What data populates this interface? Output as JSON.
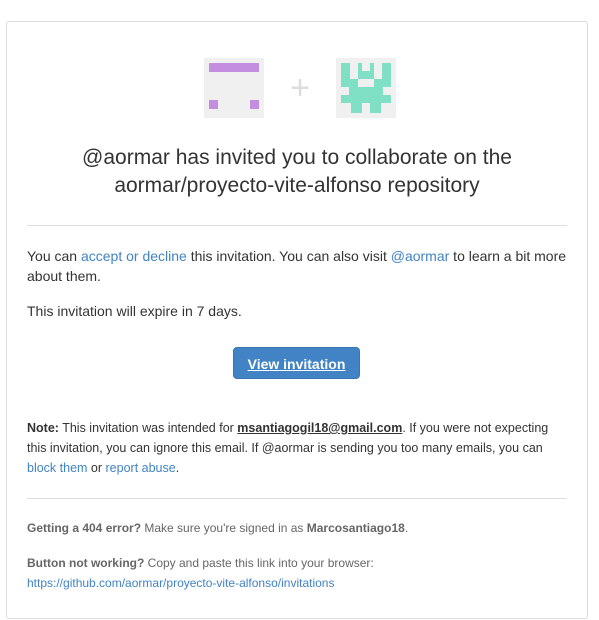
{
  "header": {
    "plus_sign": "+",
    "title_line1": "@aormar has invited you to collaborate on the",
    "title_line2": "aormar/proyecto-vite-alfonso repository"
  },
  "intro": {
    "text1": "You can ",
    "accept_link": "accept or decline",
    "text2": " this invitation. You can also visit ",
    "user_link": "@aormar",
    "text3": " to learn a bit more about them."
  },
  "expiry": "This invitation will expire in 7 days.",
  "button": {
    "label": "View invitation"
  },
  "note": {
    "label": "Note:",
    "text1": " This invitation was intended for ",
    "email": "msantiagogil18@gmail.com",
    "text2": ". If you were not expecting this invitation, you can ignore this email. If @aormar is sending you too many emails, you can ",
    "block_link": "block them",
    "text3": " or ",
    "report_link": "report abuse",
    "text4": "."
  },
  "footer": {
    "error_label": "Getting a 404 error?",
    "error_text": " Make sure you're signed in as ",
    "username": "Marcosantiago18",
    "error_end": ".",
    "button_label": "Button not working?",
    "button_text": " Copy and paste this link into your browser:",
    "url": "https://github.com/aormar/proyecto-vite-alfonso/invitations"
  },
  "colors": {
    "accent": "#4183c4",
    "avatar1": "#c38ee0",
    "avatar2": "#7fe0c6"
  }
}
